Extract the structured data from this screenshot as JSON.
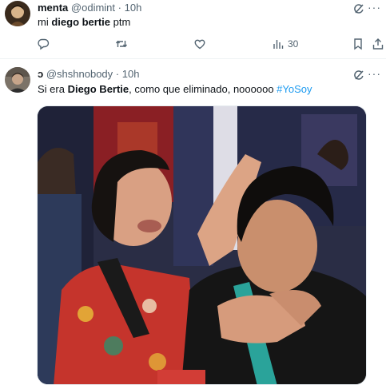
{
  "tweets": [
    {
      "name": "menta",
      "handle": "@odimint",
      "dot": "·",
      "time": "10h",
      "text_pre": "mi ",
      "text_bold": "diego bertie",
      "text_post": " ptm",
      "actions": {
        "views": "30"
      },
      "icons": [
        "reply-icon",
        "retweet-icon",
        "like-icon",
        "views-icon",
        "bookmark-icon",
        "share-icon",
        "grok-icon",
        "more-icon"
      ]
    },
    {
      "name": "ↄ",
      "handle": "@shshnobody",
      "dot": "·",
      "time": "10h",
      "text_pre": "Si era ",
      "text_bold": "Diego Bertie",
      "text_mid": ", como que eliminado, noooooo ",
      "hashtag": "#YoSoy",
      "icons": [
        "grok-icon",
        "more-icon"
      ],
      "media": {
        "kind": "photo"
      }
    }
  ],
  "more_glyph": "···",
  "colors": {
    "accent": "#1d9bf0",
    "secondary": "#536471",
    "divider": "#eff3f4"
  }
}
